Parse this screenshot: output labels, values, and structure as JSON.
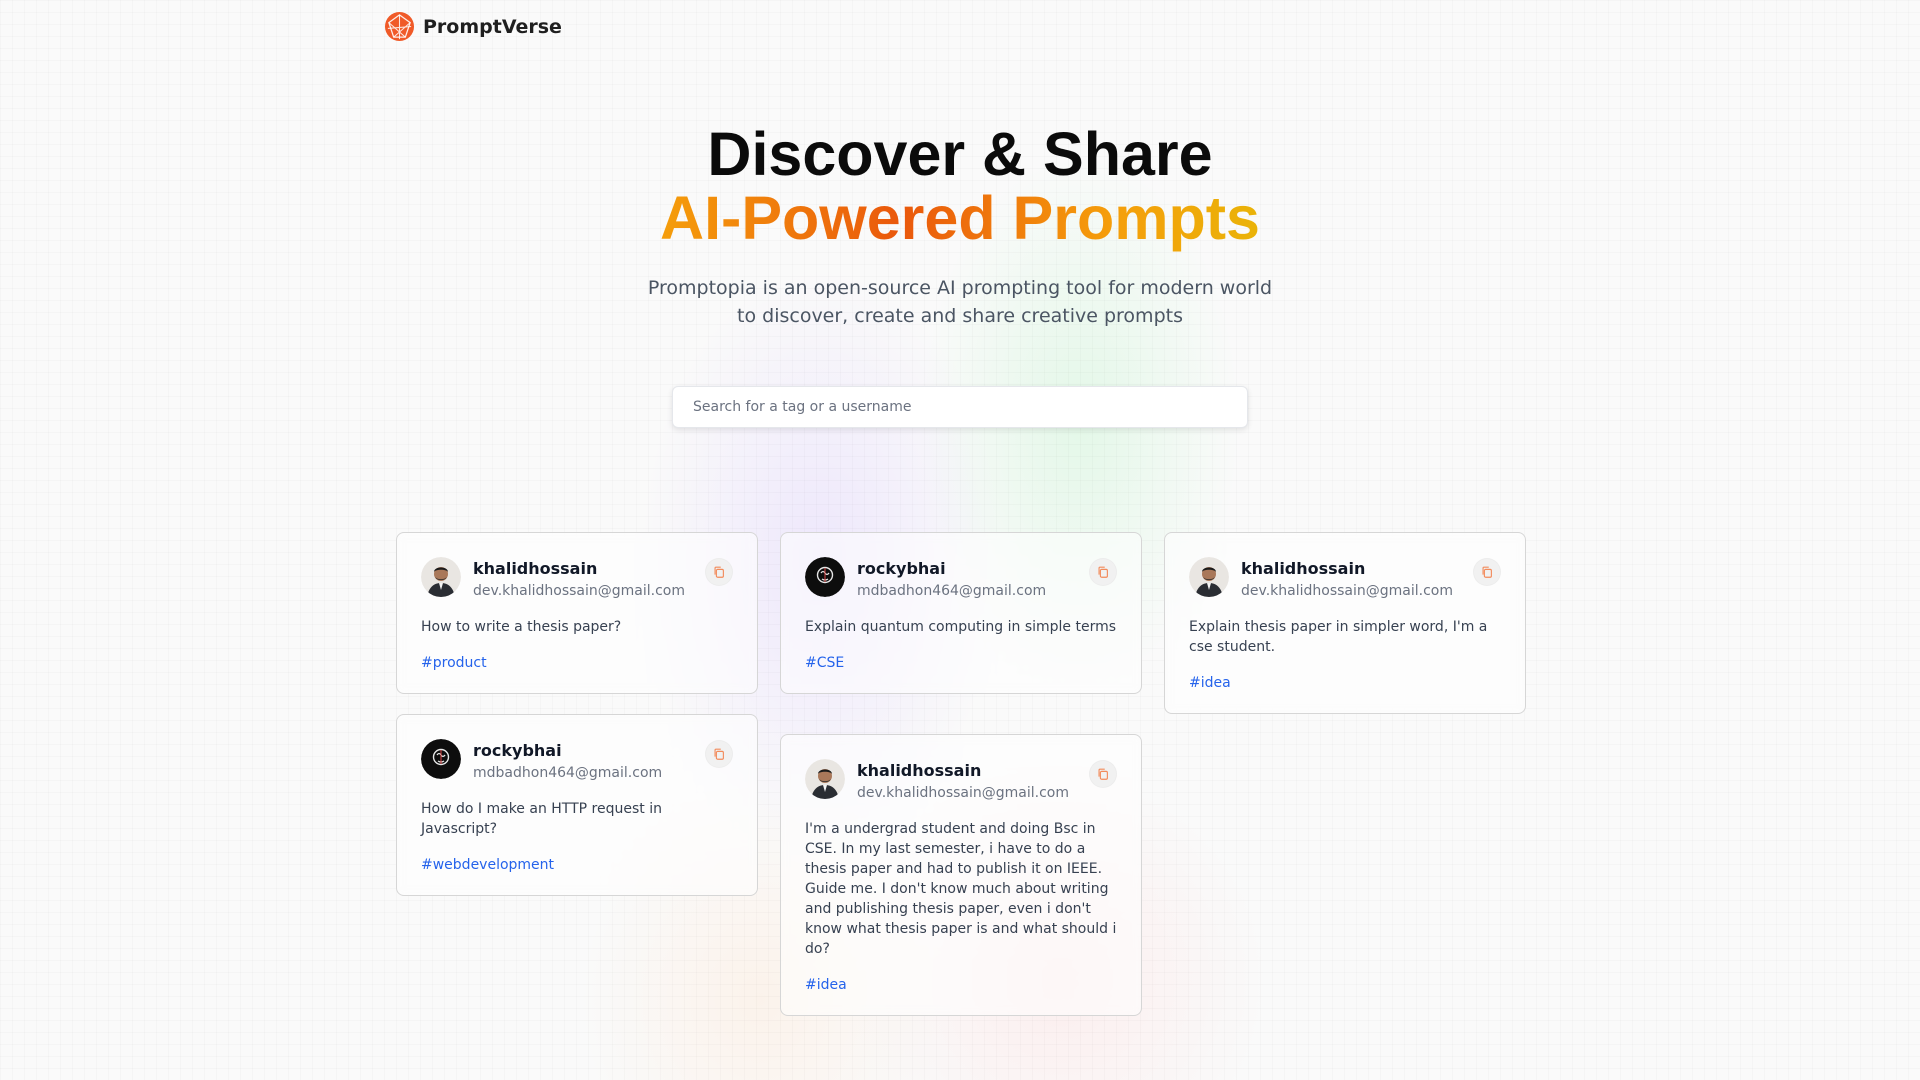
{
  "brand": {
    "name": "PromptVerse"
  },
  "hero": {
    "title_line1": "Discover & Share",
    "title_line2": "AI-Powered Prompts",
    "description": "Promptopia is an open-source AI prompting tool for modern world to discover, create and share creative prompts"
  },
  "search": {
    "placeholder": "Search for a tag or a username",
    "value": ""
  },
  "cards": [
    {
      "username": "khalidhossain",
      "email": "dev.khalidhossain@gmail.com",
      "prompt": "How to write a thesis paper?",
      "tag": "#product"
    },
    {
      "username": "rockybhai",
      "email": "mdbadhon464@gmail.com",
      "prompt": "Explain quantum computing in simple terms",
      "tag": "#CSE"
    },
    {
      "username": "khalidhossain",
      "email": "dev.khalidhossain@gmail.com",
      "prompt": "Explain thesis paper in simpler word, I'm a cse student.",
      "tag": "#idea"
    },
    {
      "username": "rockybhai",
      "email": "mdbadhon464@gmail.com",
      "prompt": "How do I make an HTTP request in Javascript?",
      "tag": "#webdevelopment"
    },
    {
      "username": "khalidhossain",
      "email": "dev.khalidhossain@gmail.com",
      "prompt": "I'm a undergrad student and doing Bsc in CSE. In my last semester, i have to do a thesis paper and had to publish it on IEEE. Guide me. I don't know much about writing and publishing thesis paper, even i don't know what thesis paper is and what should i do?",
      "tag": "#idea"
    }
  ],
  "colors": {
    "accent_orange": "#ea580c",
    "tag_blue": "#2563eb"
  },
  "icons": {
    "logo": "globe-logo-icon",
    "copy": "copy-icon",
    "avatar_photo": "user-photo",
    "avatar_dark": "dark-avatar"
  }
}
